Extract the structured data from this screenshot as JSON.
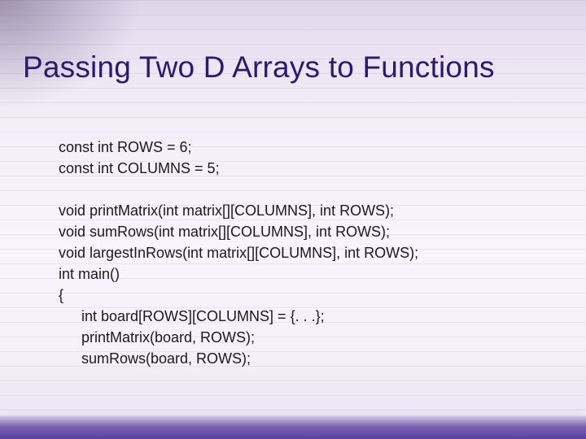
{
  "title": "Passing Two D Arrays to Functions",
  "lines": [
    "const int ROWS = 6;",
    "const int COLUMNS = 5;"
  ],
  "lines2": [
    "void printMatrix(int matrix[][COLUMNS], int ROWS);",
    "void sumRows(int matrix[][COLUMNS], int ROWS);",
    "void largestInRows(int matrix[][COLUMNS], int ROWS);",
    "int main()",
    "{"
  ],
  "lines3": [
    "int board[ROWS][COLUMNS] = {. . .};",
    "printMatrix(board, ROWS);",
    "sumRows(board, ROWS);"
  ],
  "chart_data": {
    "type": "table",
    "title": "Passing Two D Arrays to Functions",
    "constants": {
      "ROWS": 6,
      "COLUMNS": 5
    },
    "function_declarations": [
      "void printMatrix(int matrix[][COLUMNS], int ROWS);",
      "void sumRows(int matrix[][COLUMNS], int ROWS);",
      "void largestInRows(int matrix[][COLUMNS], int ROWS);"
    ],
    "main_body": [
      "int board[ROWS][COLUMNS] = {. . .};",
      "printMatrix(board, ROWS);",
      "sumRows(board, ROWS);"
    ]
  }
}
